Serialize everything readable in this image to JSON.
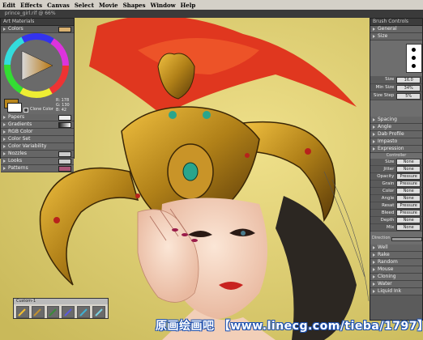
{
  "menu": [
    "Edit",
    "Effects",
    "Canvas",
    "Select",
    "Movie",
    "Shapes",
    "Window",
    "Help"
  ],
  "doc_title": " prince_girl.rif @ 66%",
  "colors_panel": {
    "title": "Art Materials",
    "header": "Colors",
    "values": [
      "R: 178",
      "G: 130",
      "B: 42"
    ],
    "clone_label": "Clone Color",
    "rows": [
      "Papers",
      "Gradients",
      "RGB Color",
      "Color Set",
      "Color Variability",
      "Nozzles",
      "Looks",
      "Patterns"
    ]
  },
  "brush_panel": {
    "title": "Brush Controls",
    "sections": [
      "General",
      "Size"
    ],
    "size_fields": [
      {
        "label": "Size",
        "value": "16.0"
      },
      {
        "label": "Min Size",
        "value": "34%"
      },
      {
        "label": "Size Step",
        "value": "5%"
      }
    ],
    "collapsed": [
      "Spacing",
      "Angle",
      "Dab Profile",
      "Impasto"
    ],
    "expression_header": "Expression",
    "controller_label": "Controller",
    "expression_fields": [
      {
        "label": "Size",
        "value": "None"
      },
      {
        "label": "Jitter",
        "value": "None"
      },
      {
        "label": "Opacity",
        "value": "Pressure"
      },
      {
        "label": "Grain",
        "value": "Pressure"
      },
      {
        "label": "Color",
        "value": "None"
      },
      {
        "label": "Angle",
        "value": "None"
      },
      {
        "label": "Resat",
        "value": "Pressure"
      },
      {
        "label": "Bleed",
        "value": "Pressure"
      },
      {
        "label": "Depth",
        "value": "None"
      },
      {
        "label": "Mix",
        "value": "None"
      }
    ],
    "direction_label": "Direction",
    "bottom_sections": [
      "Well",
      "Rake",
      "Random",
      "Mouse",
      "Cloning",
      "Water",
      "Liquid Ink"
    ]
  },
  "toolbar_title": "Custom-1",
  "watermark": "原画绘画吧  【www.linecg.com/tieba/1797】",
  "colors": {
    "accent_swatch": "#d8b070",
    "hair": "#e0371f",
    "crown": "#b8861c",
    "skin": "#f6d8c4"
  }
}
